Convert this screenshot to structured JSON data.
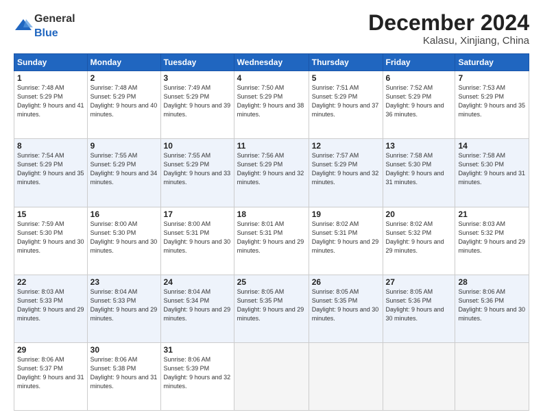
{
  "header": {
    "logo_general": "General",
    "logo_blue": "Blue",
    "month_title": "December 2024",
    "location": "Kalasu, Xinjiang, China"
  },
  "days_of_week": [
    "Sunday",
    "Monday",
    "Tuesday",
    "Wednesday",
    "Thursday",
    "Friday",
    "Saturday"
  ],
  "weeks": [
    [
      {
        "day": 1,
        "sunrise": "7:48 AM",
        "sunset": "5:29 PM",
        "daylight": "9 hours and 41 minutes."
      },
      {
        "day": 2,
        "sunrise": "7:48 AM",
        "sunset": "5:29 PM",
        "daylight": "9 hours and 40 minutes."
      },
      {
        "day": 3,
        "sunrise": "7:49 AM",
        "sunset": "5:29 PM",
        "daylight": "9 hours and 39 minutes."
      },
      {
        "day": 4,
        "sunrise": "7:50 AM",
        "sunset": "5:29 PM",
        "daylight": "9 hours and 38 minutes."
      },
      {
        "day": 5,
        "sunrise": "7:51 AM",
        "sunset": "5:29 PM",
        "daylight": "9 hours and 37 minutes."
      },
      {
        "day": 6,
        "sunrise": "7:52 AM",
        "sunset": "5:29 PM",
        "daylight": "9 hours and 36 minutes."
      },
      {
        "day": 7,
        "sunrise": "7:53 AM",
        "sunset": "5:29 PM",
        "daylight": "9 hours and 35 minutes."
      }
    ],
    [
      {
        "day": 8,
        "sunrise": "7:54 AM",
        "sunset": "5:29 PM",
        "daylight": "9 hours and 35 minutes."
      },
      {
        "day": 9,
        "sunrise": "7:55 AM",
        "sunset": "5:29 PM",
        "daylight": "9 hours and 34 minutes."
      },
      {
        "day": 10,
        "sunrise": "7:55 AM",
        "sunset": "5:29 PM",
        "daylight": "9 hours and 33 minutes."
      },
      {
        "day": 11,
        "sunrise": "7:56 AM",
        "sunset": "5:29 PM",
        "daylight": "9 hours and 32 minutes."
      },
      {
        "day": 12,
        "sunrise": "7:57 AM",
        "sunset": "5:29 PM",
        "daylight": "9 hours and 32 minutes."
      },
      {
        "day": 13,
        "sunrise": "7:58 AM",
        "sunset": "5:30 PM",
        "daylight": "9 hours and 31 minutes."
      },
      {
        "day": 14,
        "sunrise": "7:58 AM",
        "sunset": "5:30 PM",
        "daylight": "9 hours and 31 minutes."
      }
    ],
    [
      {
        "day": 15,
        "sunrise": "7:59 AM",
        "sunset": "5:30 PM",
        "daylight": "9 hours and 30 minutes."
      },
      {
        "day": 16,
        "sunrise": "8:00 AM",
        "sunset": "5:30 PM",
        "daylight": "9 hours and 30 minutes."
      },
      {
        "day": 17,
        "sunrise": "8:00 AM",
        "sunset": "5:31 PM",
        "daylight": "9 hours and 30 minutes."
      },
      {
        "day": 18,
        "sunrise": "8:01 AM",
        "sunset": "5:31 PM",
        "daylight": "9 hours and 29 minutes."
      },
      {
        "day": 19,
        "sunrise": "8:02 AM",
        "sunset": "5:31 PM",
        "daylight": "9 hours and 29 minutes."
      },
      {
        "day": 20,
        "sunrise": "8:02 AM",
        "sunset": "5:32 PM",
        "daylight": "9 hours and 29 minutes."
      },
      {
        "day": 21,
        "sunrise": "8:03 AM",
        "sunset": "5:32 PM",
        "daylight": "9 hours and 29 minutes."
      }
    ],
    [
      {
        "day": 22,
        "sunrise": "8:03 AM",
        "sunset": "5:33 PM",
        "daylight": "9 hours and 29 minutes."
      },
      {
        "day": 23,
        "sunrise": "8:04 AM",
        "sunset": "5:33 PM",
        "daylight": "9 hours and 29 minutes."
      },
      {
        "day": 24,
        "sunrise": "8:04 AM",
        "sunset": "5:34 PM",
        "daylight": "9 hours and 29 minutes."
      },
      {
        "day": 25,
        "sunrise": "8:05 AM",
        "sunset": "5:35 PM",
        "daylight": "9 hours and 29 minutes."
      },
      {
        "day": 26,
        "sunrise": "8:05 AM",
        "sunset": "5:35 PM",
        "daylight": "9 hours and 30 minutes."
      },
      {
        "day": 27,
        "sunrise": "8:05 AM",
        "sunset": "5:36 PM",
        "daylight": "9 hours and 30 minutes."
      },
      {
        "day": 28,
        "sunrise": "8:06 AM",
        "sunset": "5:36 PM",
        "daylight": "9 hours and 30 minutes."
      }
    ],
    [
      {
        "day": 29,
        "sunrise": "8:06 AM",
        "sunset": "5:37 PM",
        "daylight": "9 hours and 31 minutes."
      },
      {
        "day": 30,
        "sunrise": "8:06 AM",
        "sunset": "5:38 PM",
        "daylight": "9 hours and 31 minutes."
      },
      {
        "day": 31,
        "sunrise": "8:06 AM",
        "sunset": "5:39 PM",
        "daylight": "9 hours and 32 minutes."
      },
      null,
      null,
      null,
      null
    ]
  ]
}
